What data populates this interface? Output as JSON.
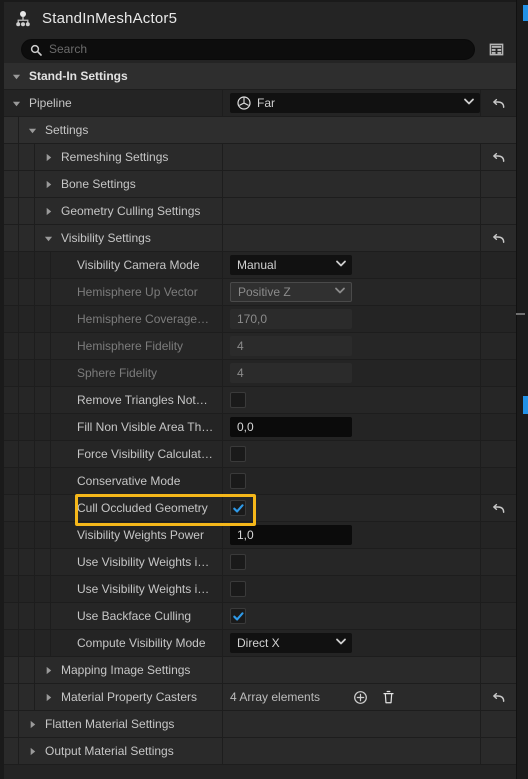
{
  "window": {
    "title": "StandInMeshActor5",
    "actor_icon": "actor-hierarchy-icon"
  },
  "search": {
    "placeholder": "Search",
    "value": "",
    "icon": "search-icon",
    "grid_button_icon": "table-grid-icon"
  },
  "colors": {
    "highlight": "#f5b71a",
    "checkbox_check": "#2f9ae8",
    "panel_bg": "#242424",
    "category_bg": "#2e2e2e"
  },
  "rows": [
    {
      "id": "stand-in-settings",
      "label": "Stand-In Settings",
      "kind": "category",
      "indent": 0,
      "expanded": true,
      "twisty": "down",
      "bold": true
    },
    {
      "id": "pipeline",
      "label": "Pipeline",
      "kind": "property",
      "indent": 0,
      "expanded": true,
      "twisty": "down",
      "widget": "combo-asset",
      "value": "Far",
      "asset_icon": "globe-icon",
      "reset": true
    },
    {
      "id": "settings",
      "label": "Settings",
      "kind": "category",
      "indent": 1,
      "expanded": true,
      "twisty": "down"
    },
    {
      "id": "remeshing-settings",
      "label": "Remeshing Settings",
      "kind": "group",
      "indent": 2,
      "expanded": false,
      "twisty": "right",
      "reset": true
    },
    {
      "id": "bone-settings",
      "label": "Bone Settings",
      "kind": "group",
      "indent": 2,
      "expanded": false,
      "twisty": "right"
    },
    {
      "id": "geometry-culling-settings",
      "label": "Geometry Culling Settings",
      "kind": "group",
      "indent": 2,
      "expanded": false,
      "twisty": "right"
    },
    {
      "id": "visibility-settings",
      "label": "Visibility Settings",
      "kind": "group",
      "indent": 2,
      "expanded": true,
      "twisty": "down",
      "reset": true
    },
    {
      "id": "visibility-camera-mode",
      "label": "Visibility Camera Mode",
      "kind": "property",
      "indent": 3,
      "widget": "combo",
      "value": "Manual",
      "disabled": false
    },
    {
      "id": "hemisphere-up-vector",
      "label": "Hemisphere Up Vector",
      "kind": "property",
      "indent": 3,
      "widget": "combo",
      "value": "Positive Z",
      "disabled": true
    },
    {
      "id": "hemisphere-coverage",
      "label": "Hemisphere Coverage…",
      "kind": "property",
      "indent": 3,
      "widget": "number",
      "value": "170,0",
      "disabled": true
    },
    {
      "id": "hemisphere-fidelity",
      "label": "Hemisphere Fidelity",
      "kind": "property",
      "indent": 3,
      "widget": "number",
      "value": "4",
      "disabled": true
    },
    {
      "id": "sphere-fidelity",
      "label": "Sphere Fidelity",
      "kind": "property",
      "indent": 3,
      "widget": "number",
      "value": "4",
      "disabled": true
    },
    {
      "id": "remove-triangles-not",
      "label": "Remove Triangles Not…",
      "kind": "property",
      "indent": 3,
      "widget": "checkbox",
      "checked": false
    },
    {
      "id": "fill-non-visible-area-th",
      "label": "Fill Non Visible Area Th…",
      "kind": "property",
      "indent": 3,
      "widget": "number",
      "value": "0,0",
      "disabled": false
    },
    {
      "id": "force-visibility-calculat",
      "label": "Force Visibility Calculat…",
      "kind": "property",
      "indent": 3,
      "widget": "checkbox",
      "checked": false
    },
    {
      "id": "conservative-mode",
      "label": "Conservative Mode",
      "kind": "property",
      "indent": 3,
      "widget": "checkbox",
      "checked": false
    },
    {
      "id": "cull-occluded-geometry",
      "label": "Cull Occluded Geometry",
      "kind": "property",
      "indent": 3,
      "widget": "checkbox",
      "checked": true,
      "reset": true,
      "highlighted": true
    },
    {
      "id": "visibility-weights-power",
      "label": "Visibility Weights Power",
      "kind": "property",
      "indent": 3,
      "widget": "number",
      "value": "1,0",
      "disabled": false
    },
    {
      "id": "use-visibility-weights-i-1",
      "label": "Use Visibility Weights i…",
      "kind": "property",
      "indent": 3,
      "widget": "checkbox",
      "checked": false
    },
    {
      "id": "use-visibility-weights-i-2",
      "label": "Use Visibility Weights i…",
      "kind": "property",
      "indent": 3,
      "widget": "checkbox",
      "checked": false
    },
    {
      "id": "use-backface-culling",
      "label": "Use Backface Culling",
      "kind": "property",
      "indent": 3,
      "widget": "checkbox",
      "checked": true
    },
    {
      "id": "compute-visibility-mode",
      "label": "Compute Visibility Mode",
      "kind": "property",
      "indent": 3,
      "widget": "combo",
      "value": "Direct X",
      "disabled": false
    },
    {
      "id": "mapping-image-settings",
      "label": "Mapping Image Settings",
      "kind": "group",
      "indent": 2,
      "expanded": false,
      "twisty": "right"
    },
    {
      "id": "material-property-casters",
      "label": "Material Property Casters",
      "kind": "group",
      "indent": 2,
      "expanded": false,
      "twisty": "right",
      "widget": "array",
      "value": "4 Array elements",
      "add_icon": "plus-circle-icon",
      "delete_icon": "trash-icon",
      "reset": true
    },
    {
      "id": "flatten-material-settings",
      "label": "Flatten Material Settings",
      "kind": "group",
      "indent": 1,
      "expanded": false,
      "twisty": "right"
    },
    {
      "id": "output-material-settings",
      "label": "Output Material Settings",
      "kind": "group",
      "indent": 1,
      "expanded": false,
      "twisty": "right"
    }
  ]
}
